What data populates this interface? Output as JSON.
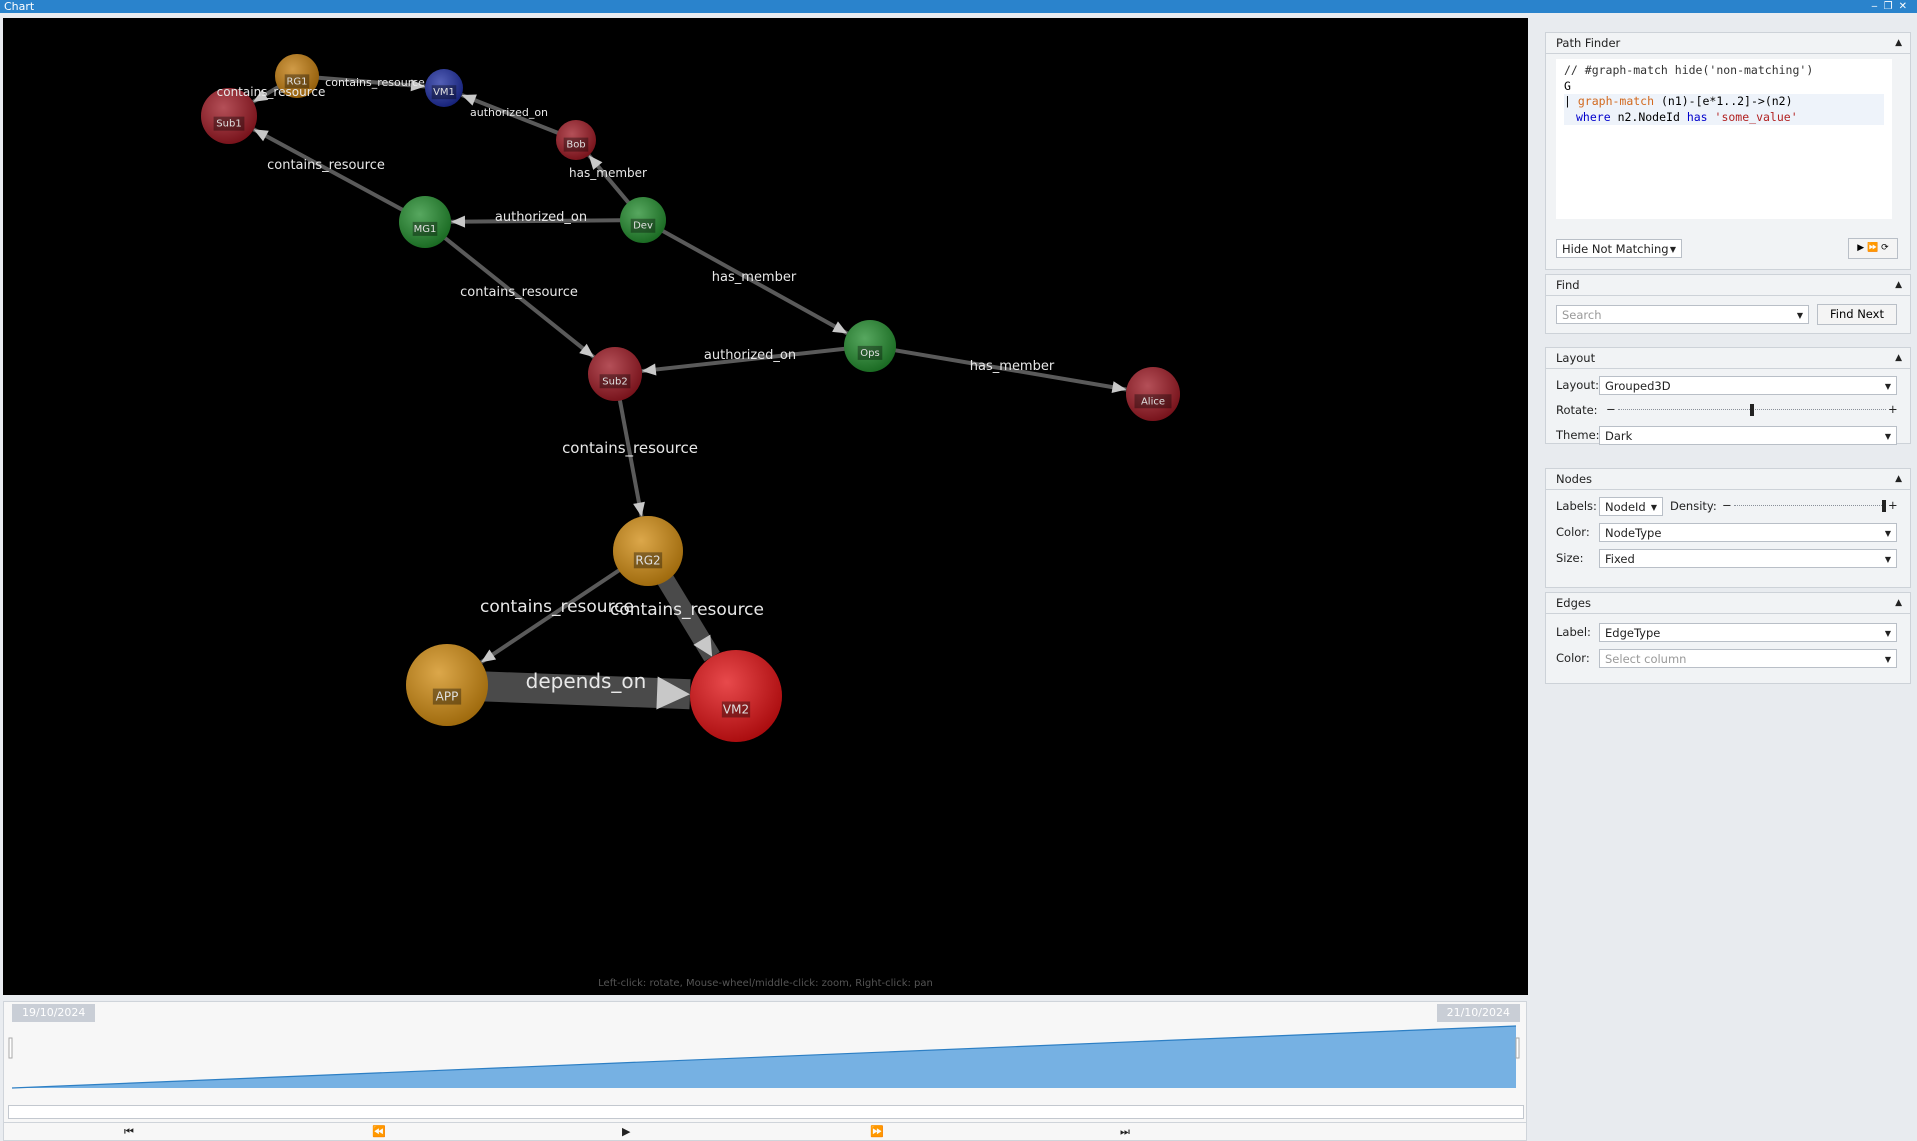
{
  "window": {
    "title": "Chart",
    "controls": [
      "‒",
      "❐",
      "✕"
    ]
  },
  "graph": {
    "hint": "Left-click: rotate, Mouse-wheel/middle-click: zoom, Right-click: pan",
    "nodes": [
      {
        "id": "RG1",
        "color": "#c17a0a"
      },
      {
        "id": "VM1",
        "color": "#1a2a9e"
      },
      {
        "id": "Sub1",
        "color": "#9b1520"
      },
      {
        "id": "Bob",
        "color": "#9b1520"
      },
      {
        "id": "MG1",
        "color": "#1f8a2a"
      },
      {
        "id": "Dev",
        "color": "#1f8a2a"
      },
      {
        "id": "Ops",
        "color": "#1f8a2a"
      },
      {
        "id": "Sub2",
        "color": "#9b1520"
      },
      {
        "id": "Alice",
        "color": "#9b1520"
      },
      {
        "id": "RG2",
        "color": "#d08a0e"
      },
      {
        "id": "APP",
        "color": "#d08a0e"
      },
      {
        "id": "VM2",
        "color": "#e00d10"
      }
    ],
    "edges": [
      {
        "from": "RG1",
        "to": "Sub1",
        "label": "contains_resource"
      },
      {
        "from": "RG1",
        "to": "VM1",
        "label": "contains_resource"
      },
      {
        "from": "Bob",
        "to": "VM1",
        "label": "authorized_on"
      },
      {
        "from": "MG1",
        "to": "Sub1",
        "label": "contains_resource"
      },
      {
        "from": "Dev",
        "to": "Bob",
        "label": "has_member"
      },
      {
        "from": "Dev",
        "to": "MG1",
        "label": "authorized_on"
      },
      {
        "from": "Dev",
        "to": "Ops",
        "label": "has_member"
      },
      {
        "from": "MG1",
        "to": "Sub2",
        "label": "contains_resource"
      },
      {
        "from": "Ops",
        "to": "Sub2",
        "label": "authorized_on"
      },
      {
        "from": "Ops",
        "to": "Alice",
        "label": "has_member"
      },
      {
        "from": "Sub2",
        "to": "RG2",
        "label": "contains_resource"
      },
      {
        "from": "RG2",
        "to": "APP",
        "label": "contains_resource"
      },
      {
        "from": "RG2",
        "to": "VM2",
        "label": "contains_resource"
      },
      {
        "from": "APP",
        "to": "VM2",
        "label": "depends_on"
      }
    ]
  },
  "timeline": {
    "start_date": "19/10/2024",
    "end_date": "21/10/2024",
    "fill_color": "#76b1e3",
    "controls": [
      "⏮",
      "⏪",
      "▶",
      "⏩",
      "⏭"
    ]
  },
  "path_finder": {
    "title": "Path Finder",
    "code": {
      "line1": "// #graph-match hide('non-matching')",
      "line2": "G",
      "line3_bar": "|",
      "line3_kw": "graph-match",
      "line3_rest": " (n1)-[e*1..2]->(n2)",
      "line4_where": "where",
      "line4_field": "n2.NodeId",
      "line4_has": "has",
      "line4_value": "'some_value'"
    },
    "mode": "Hide Not Matching",
    "run_icons": [
      "▶",
      "⏩",
      "⟳"
    ]
  },
  "find": {
    "title": "Find",
    "placeholder": "Search",
    "button": "Find Next"
  },
  "layout_panel": {
    "title": "Layout",
    "layout_label": "Layout:",
    "layout_value": "Grouped3D",
    "rotate_label": "Rotate:",
    "rotate_minus": "−",
    "rotate_plus": "+",
    "rotate_level": 0.5,
    "theme_label": "Theme:",
    "theme_value": "Dark"
  },
  "nodes_panel": {
    "title": "Nodes",
    "labels_label": "Labels:",
    "labels_value": "NodeId",
    "density_label": "Density:",
    "density_minus": "−",
    "density_plus": "+",
    "density_level": 1.0,
    "color_label": "Color:",
    "color_value": "NodeType",
    "size_label": "Size:",
    "size_value": "Fixed"
  },
  "edges_panel": {
    "title": "Edges",
    "label_label": "Label:",
    "label_value": "EdgeType",
    "color_label": "Color:",
    "color_placeholder": "Select column"
  }
}
